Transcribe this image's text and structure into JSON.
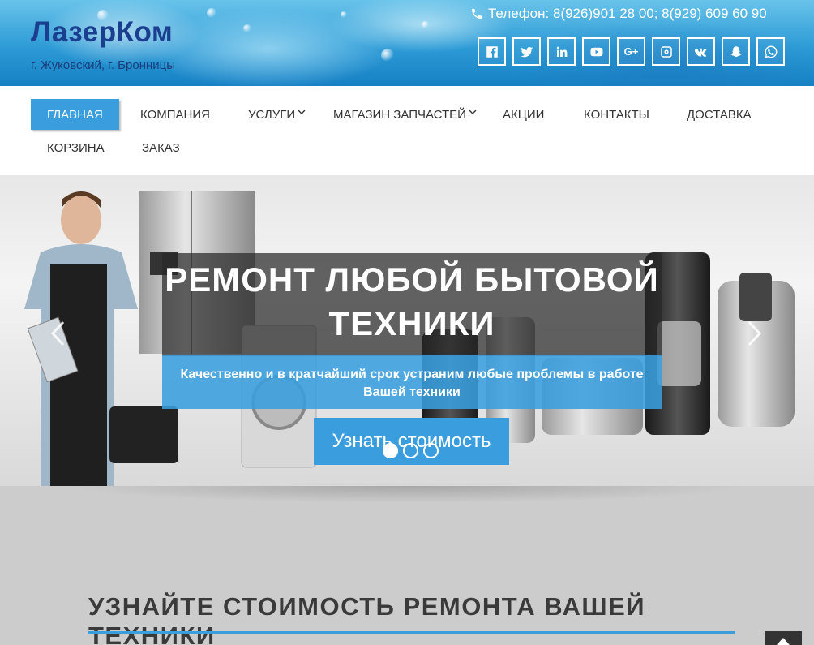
{
  "header": {
    "logo": "ЛазерКом",
    "tagline": "г. Жуковский, г. Бронницы",
    "phone_text": "Телефон: 8(926)901 28 00; 8(929) 609 60 90",
    "phone_icon": "phone-icon",
    "socials": [
      {
        "name": "facebook-icon"
      },
      {
        "name": "twitter-icon"
      },
      {
        "name": "linkedin-icon"
      },
      {
        "name": "youtube-icon"
      },
      {
        "name": "google-plus-icon",
        "label": "G+"
      },
      {
        "name": "instagram-icon"
      },
      {
        "name": "vk-icon"
      },
      {
        "name": "snapchat-icon"
      },
      {
        "name": "whatsapp-icon"
      }
    ]
  },
  "nav": {
    "items": [
      {
        "label": "ГЛАВНАЯ",
        "active": true
      },
      {
        "label": "КОМПАНИЯ"
      },
      {
        "label": "УСЛУГИ",
        "dropdown": true
      },
      {
        "label": "МАГАЗИН ЗАПЧАСТЕЙ",
        "dropdown": true
      },
      {
        "label": "АКЦИИ"
      },
      {
        "label": "КОНТАКТЫ"
      },
      {
        "label": "ДОСТАВКА"
      },
      {
        "label": "КОРЗИНА"
      },
      {
        "label": "ЗАКАЗ"
      }
    ]
  },
  "slider": {
    "title_line1": "РЕМОНТ ЛЮБОЙ БЫТОВОЙ",
    "title_line2": "ТЕХНИКИ",
    "subtitle": "Качественно и в кратчайший срок устраним любые проблемы в работе Вашей техники",
    "cta": "Узнать стоимость",
    "dots_total": 3,
    "active_dot": 1
  },
  "section": {
    "title": "УЗНАЙТЕ СТОИМОСТЬ РЕМОНТА ВАШЕЙ ТЕХНИКИ"
  },
  "colors": {
    "accent": "#3a9ede",
    "logo": "#1a3f8f"
  }
}
